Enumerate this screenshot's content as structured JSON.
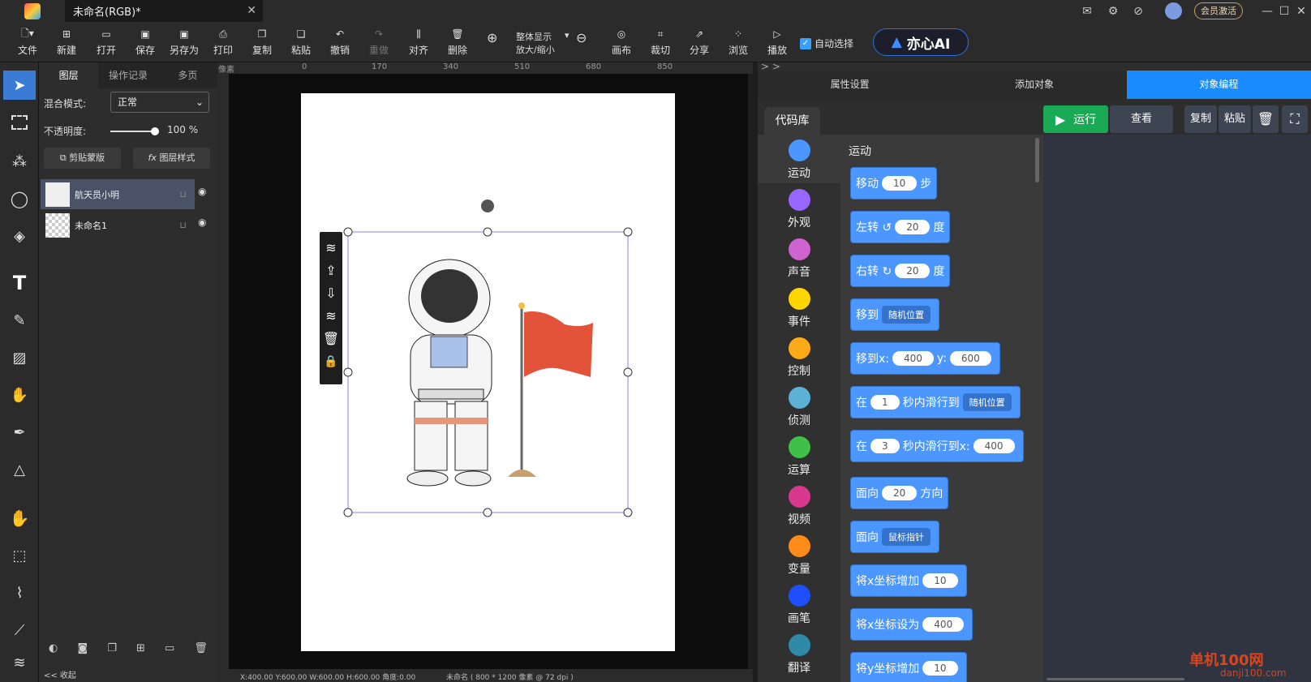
{
  "title_bar": {
    "doc_tab": "未命名(RGB)*",
    "vip_label": "会员激活"
  },
  "toolbar": {
    "items": [
      "文件",
      "新建",
      "打开",
      "保存",
      "另存为",
      "打印",
      "复制",
      "粘贴",
      "撤销",
      "重做",
      "对齐",
      "删除",
      "画布",
      "裁切",
      "分享",
      "浏览",
      "播放"
    ],
    "zoom_top": "整体显示",
    "zoom_bottom": "放大/缩小",
    "auto_select": "自动选择",
    "ai_label": "亦心AI"
  },
  "layers_panel": {
    "tabs": [
      "图层",
      "操作记录",
      "多页"
    ],
    "blend_label": "混合模式:",
    "blend_value": "正常",
    "opacity_label": "不透明度:",
    "opacity_value": "100 %",
    "clip_label": "剪贴蒙版",
    "style_label": "图层样式",
    "layers": [
      "航天员小明",
      "未命名1"
    ],
    "collapse": "<<  收起"
  },
  "ruler": {
    "unit": "像素",
    "ticks": [
      "0",
      "170",
      "340",
      "510",
      "680",
      "850"
    ]
  },
  "status": {
    "coords": "X:400.00 Y:600.00 W:600.00 H:600.00 角度:0.00",
    "docinfo": "未命名 ( 800 * 1200 像素 @ 72 dpi )"
  },
  "right_panel": {
    "tabs": [
      "属性设置",
      "添加对象",
      "对象编程"
    ],
    "codelib": "代码库",
    "run": "运行",
    "view": "查看",
    "copy": "复制",
    "paste": "粘贴",
    "section": "运动",
    "categories": [
      {
        "name": "运动",
        "color": "#4c97ff"
      },
      {
        "name": "外观",
        "color": "#9966ff"
      },
      {
        "name": "声音",
        "color": "#cf63cf"
      },
      {
        "name": "事件",
        "color": "#ffd500"
      },
      {
        "name": "控制",
        "color": "#ffab19"
      },
      {
        "name": "侦测",
        "color": "#5cb1d6"
      },
      {
        "name": "运算",
        "color": "#40bf4a"
      },
      {
        "name": "视频",
        "color": "#d9388f"
      },
      {
        "name": "变量",
        "color": "#ff8c1a"
      },
      {
        "name": "画笔",
        "color": "#1e4fff"
      },
      {
        "name": "翻译",
        "color": "#2e8aa6"
      }
    ],
    "blocks": [
      {
        "pre": "移动",
        "v1": "10",
        "post": "步"
      },
      {
        "pre": "左转 ↺",
        "v1": "20",
        "post": "度"
      },
      {
        "pre": "右转 ↻",
        "v1": "20",
        "post": "度"
      },
      {
        "pre": "移到",
        "dd": "随机位置"
      },
      {
        "pre": "移到x:",
        "v1": "400",
        "mid": "y:",
        "v2": "600"
      },
      {
        "pre": "在",
        "v1": "1",
        "mid": "秒内滑行到",
        "dd": "随机位置"
      },
      {
        "pre": "在",
        "v1": "3",
        "mid": "秒内滑行到x:",
        "v2": "400"
      },
      {
        "pre": "面向",
        "v1": "20",
        "post": "方向"
      },
      {
        "pre": "面向",
        "dd": "鼠标指针"
      },
      {
        "pre": "将x坐标增加",
        "v1": "10"
      },
      {
        "pre": "将x坐标设为",
        "v1": "400"
      },
      {
        "pre": "将y坐标增加",
        "v1": "10"
      }
    ]
  },
  "watermark": {
    "name": "单机100网",
    "url": "danji100.com"
  }
}
